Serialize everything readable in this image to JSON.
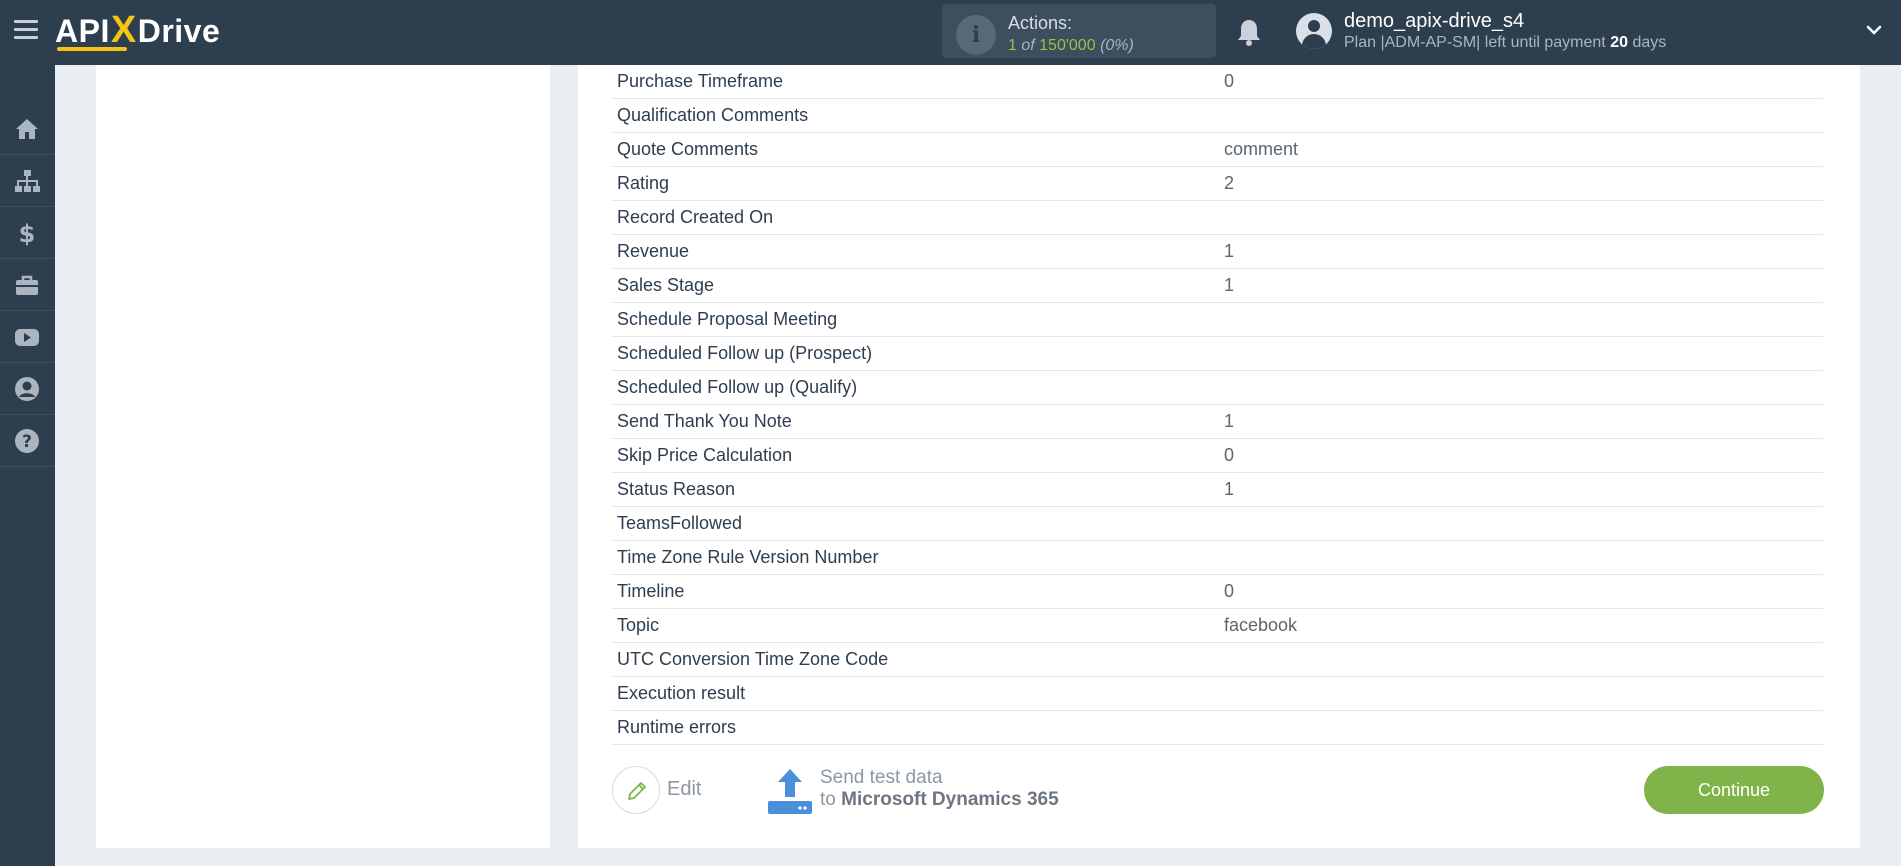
{
  "header": {
    "logo": {
      "api": "API",
      "x": "X",
      "drive": "Drive"
    },
    "actions": {
      "title": "Actions:",
      "used": "1",
      "of": "of",
      "total": "150'000",
      "percent": "(0%)"
    },
    "user": {
      "name": "demo_apix-drive_s4",
      "plan_prefix": "Plan |ADM-AP-SM| left until payment",
      "days": "20",
      "days_suffix": "days"
    }
  },
  "sidebar": {
    "items": [
      {
        "icon": "home-icon"
      },
      {
        "icon": "sitemap-icon"
      },
      {
        "icon": "dollar-icon"
      },
      {
        "icon": "briefcase-icon"
      },
      {
        "icon": "youtube-icon"
      },
      {
        "icon": "user-circle-icon"
      },
      {
        "icon": "question-circle-icon"
      }
    ]
  },
  "table": {
    "rows": [
      {
        "field": "Purchase Timeframe",
        "value": "0"
      },
      {
        "field": "Qualification Comments",
        "value": ""
      },
      {
        "field": "Quote Comments",
        "value": "comment"
      },
      {
        "field": "Rating",
        "value": "2"
      },
      {
        "field": "Record Created On",
        "value": ""
      },
      {
        "field": "Revenue",
        "value": "1"
      },
      {
        "field": "Sales Stage",
        "value": "1"
      },
      {
        "field": "Schedule Proposal Meeting",
        "value": ""
      },
      {
        "field": "Scheduled Follow up (Prospect)",
        "value": ""
      },
      {
        "field": "Scheduled Follow up (Qualify)",
        "value": ""
      },
      {
        "field": "Send Thank You Note",
        "value": "1"
      },
      {
        "field": "Skip Price Calculation",
        "value": "0"
      },
      {
        "field": "Status Reason",
        "value": "1"
      },
      {
        "field": "TeamsFollowed",
        "value": ""
      },
      {
        "field": "Time Zone Rule Version Number",
        "value": ""
      },
      {
        "field": "Timeline",
        "value": "0"
      },
      {
        "field": "Topic",
        "value": "facebook"
      },
      {
        "field": "UTC Conversion Time Zone Code",
        "value": ""
      },
      {
        "field": "Execution result",
        "value": ""
      },
      {
        "field": "Runtime errors",
        "value": ""
      }
    ]
  },
  "footer": {
    "edit_label": "Edit",
    "send_line1": "Send test data",
    "send_to": "to",
    "send_target": "Microsoft Dynamics 365",
    "continue_label": "Continue"
  },
  "colors": {
    "topbar": "#2d3e4f",
    "accent_green": "#80b44a",
    "logo_yellow": "#f3c316",
    "send_icon_blue": "#4a90d9"
  }
}
